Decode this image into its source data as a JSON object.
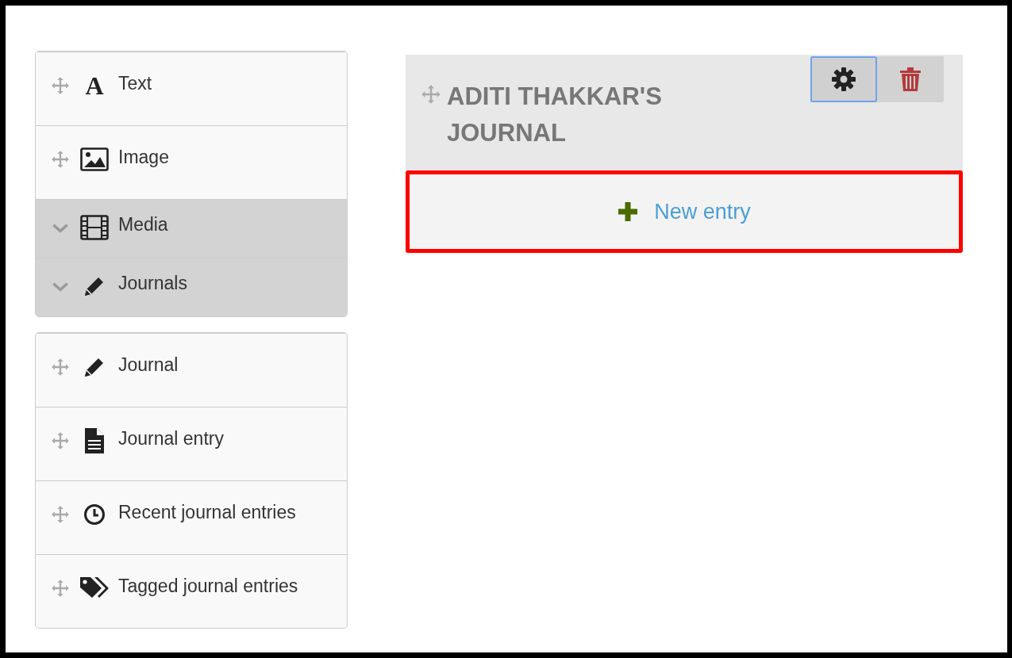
{
  "panels": [
    {
      "items": [
        {
          "kind": "drag",
          "glyph": "A",
          "label": "Text"
        },
        {
          "kind": "drag",
          "label": "Image"
        },
        {
          "kind": "expand",
          "label": "Media"
        },
        {
          "kind": "expand",
          "label": "Journals"
        }
      ]
    },
    {
      "items": [
        {
          "kind": "drag",
          "label": "Journal"
        },
        {
          "kind": "drag",
          "label": "Journal entry"
        },
        {
          "kind": "drag",
          "label": "Recent journal entries"
        },
        {
          "kind": "drag",
          "label": "Tagged journal entries"
        }
      ]
    }
  ],
  "journal_block": {
    "title": "ADITI THAKKAR'S JOURNAL",
    "buttons": [
      {
        "kind": "settings",
        "focused": true
      },
      {
        "kind": "delete",
        "focused": false
      }
    ],
    "new_entry": {
      "label": "New entry",
      "highlighted": true
    }
  }
}
